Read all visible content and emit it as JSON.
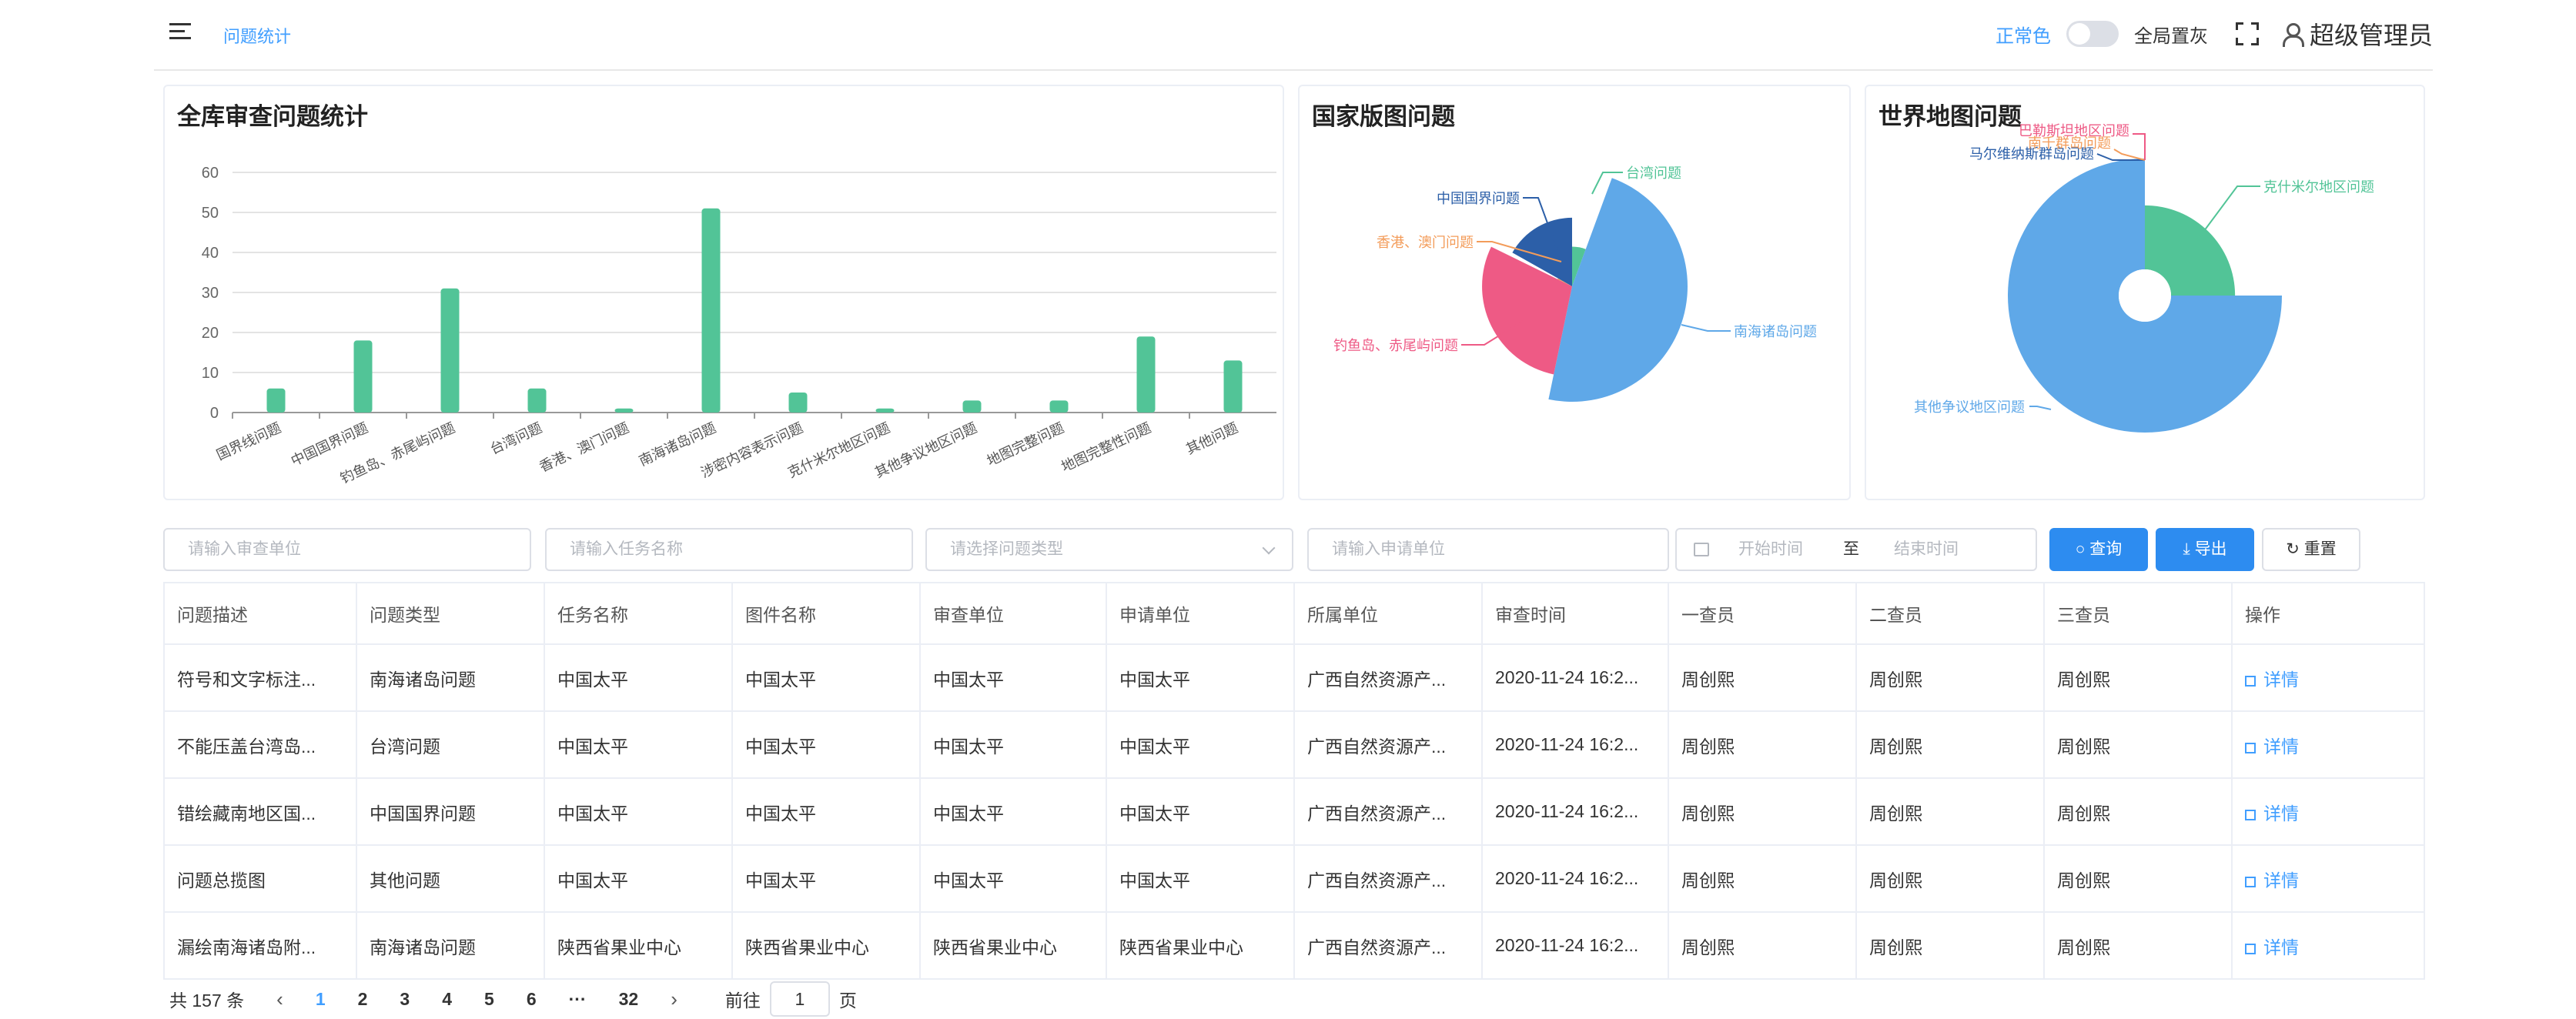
{
  "header": {
    "breadcrumb": "问题统计",
    "normal_color_label": "正常色",
    "gray_label": "全局置灰",
    "user_name": "超级管理员"
  },
  "cards": {
    "bar_title": "全库审查问题统计",
    "china_title": "国家版图问题",
    "world_title": "世界地图问题"
  },
  "chart_data": [
    {
      "type": "bar",
      "title": "全库审查问题统计",
      "categories": [
        "国界线问题",
        "中国国界问题",
        "钓鱼岛、赤尾屿问题",
        "台湾问题",
        "香港、澳门问题",
        "南海诸岛问题",
        "涉密内容表示问题",
        "克什米尔地区问题",
        "其他争议地区问题",
        "地图完整问题",
        "地图完整性问题",
        "其他问题"
      ],
      "values": [
        6,
        18,
        31,
        6,
        1,
        51,
        5,
        1,
        3,
        3,
        19,
        13
      ],
      "yticks": [
        "0",
        "10",
        "20",
        "30",
        "40",
        "50",
        "60"
      ],
      "ylim": [
        0,
        60
      ],
      "color": "#52c497"
    },
    {
      "type": "pie",
      "title": "国家版图问题",
      "labels": [
        "台湾问题",
        "南海诸岛问题",
        "钓鱼岛、赤尾屿问题",
        "香港、澳门问题",
        "中国国界问题"
      ],
      "values": [
        6,
        51,
        31,
        1,
        18
      ],
      "colors": [
        "#52c497",
        "#5fa8e8",
        "#ee5a85",
        "#f39c5a",
        "#2c5fa8"
      ]
    },
    {
      "type": "pie",
      "title": "世界地图问题",
      "labels": [
        "克什米尔地区问题",
        "其他争议地区问题",
        "马尔维纳斯群岛问题",
        "南千群岛问题",
        "巴勒斯坦地区问题"
      ],
      "values": [
        1,
        3,
        0,
        0,
        0
      ],
      "colors": [
        "#52c497",
        "#5fa8e8",
        "#2c5fa8",
        "#f39c5a",
        "#ee5a85"
      ]
    }
  ],
  "filters": {
    "audit_unit": "请输入审查单位",
    "task_name": "请输入任务名称",
    "problem_type": "请选择问题类型",
    "apply_unit": "请输入申请单位",
    "start_time": "开始时间",
    "to": "至",
    "end_time": "结束时间",
    "search": "查询",
    "export": "导出",
    "reset": "重置"
  },
  "table": {
    "headers": [
      "问题描述",
      "问题类型",
      "任务名称",
      "图件名称",
      "审查单位",
      "申请单位",
      "所属单位",
      "审查时间",
      "一查员",
      "二查员",
      "三查员",
      "操作"
    ],
    "rows": [
      [
        "符号和文字标注...",
        "南海诸岛问题",
        "中国太平",
        "中国太平",
        "中国太平",
        "中国太平",
        "广西自然资源产...",
        "2020-11-24 16:2...",
        "周创熙",
        "周创熙",
        "周创熙",
        "详情"
      ],
      [
        "不能压盖台湾岛...",
        "台湾问题",
        "中国太平",
        "中国太平",
        "中国太平",
        "中国太平",
        "广西自然资源产...",
        "2020-11-24 16:2...",
        "周创熙",
        "周创熙",
        "周创熙",
        "详情"
      ],
      [
        "错绘藏南地区国...",
        "中国国界问题",
        "中国太平",
        "中国太平",
        "中国太平",
        "中国太平",
        "广西自然资源产...",
        "2020-11-24 16:2...",
        "周创熙",
        "周创熙",
        "周创熙",
        "详情"
      ],
      [
        "问题总揽图",
        "其他问题",
        "中国太平",
        "中国太平",
        "中国太平",
        "中国太平",
        "广西自然资源产...",
        "2020-11-24 16:2...",
        "周创熙",
        "周创熙",
        "周创熙",
        "详情"
      ],
      [
        "漏绘南海诸岛附...",
        "南海诸岛问题",
        "陕西省果业中心",
        "陕西省果业中心",
        "陕西省果业中心",
        "陕西省果业中心",
        "广西自然资源产...",
        "2020-11-24 16:2...",
        "周创熙",
        "周创熙",
        "周创熙",
        "详情"
      ]
    ]
  },
  "pager": {
    "total": "共 157 条",
    "prev": "‹",
    "pages": [
      "1",
      "2",
      "3",
      "4",
      "5",
      "6",
      "···",
      "32"
    ],
    "next": "›",
    "goto": "前往",
    "current": "1",
    "page_unit": "页"
  }
}
